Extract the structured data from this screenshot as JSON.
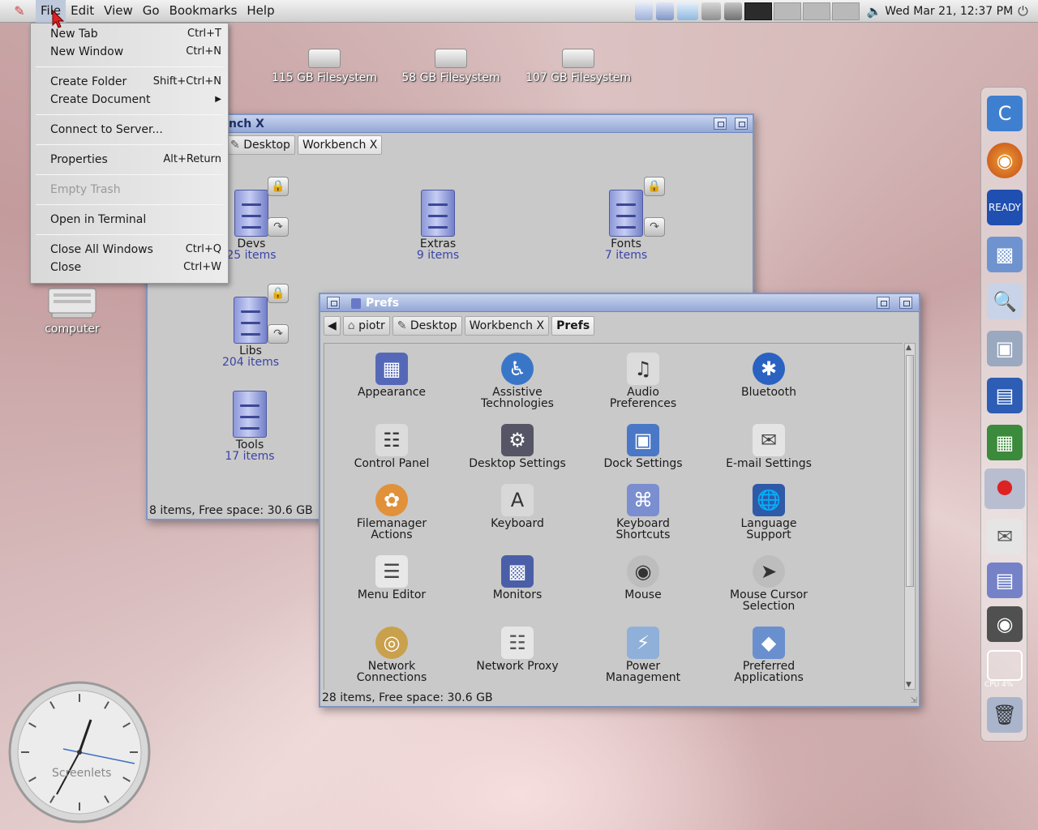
{
  "top_panel": {
    "menus": [
      "File",
      "Edit",
      "View",
      "Go",
      "Bookmarks",
      "Help"
    ],
    "datetime": "Wed Mar 21, 12:37 PM"
  },
  "file_menu": {
    "new_tab": {
      "label": "New Tab",
      "accel": "Ctrl+T"
    },
    "new_window": {
      "label": "New Window",
      "accel": "Ctrl+N"
    },
    "create_folder": {
      "label": "Create Folder",
      "accel": "Shift+Ctrl+N"
    },
    "create_document": {
      "label": "Create Document"
    },
    "connect_server": {
      "label": "Connect to Server..."
    },
    "properties": {
      "label": "Properties",
      "accel": "Alt+Return"
    },
    "empty_trash": {
      "label": "Empty Trash"
    },
    "open_terminal": {
      "label": "Open in Terminal"
    },
    "close_all": {
      "label": "Close All Windows",
      "accel": "Ctrl+Q"
    },
    "close": {
      "label": "Close",
      "accel": "Ctrl+W"
    }
  },
  "desktop": {
    "drives": [
      "115 GB Filesystem",
      "58 GB Filesystem",
      "107 GB Filesystem"
    ],
    "computer_label": "computer"
  },
  "workbench_window": {
    "title": "nch X",
    "crumbs": [
      "Desktop",
      "Workbench X"
    ],
    "items": [
      {
        "name": "Devs",
        "count": "25 items"
      },
      {
        "name": "Extras",
        "count": "9 items"
      },
      {
        "name": "Fonts",
        "count": "7 items"
      },
      {
        "name": "Libs",
        "count": "204 items"
      },
      {
        "name": "Tools",
        "count": "17 items"
      }
    ],
    "status": "8 items, Free space: 30.6 GB"
  },
  "prefs_window": {
    "title": "Prefs",
    "crumbs": [
      "piotr",
      "Desktop",
      "Workbench X",
      "Prefs"
    ],
    "items": [
      {
        "line1": "Appearance",
        "line2": ""
      },
      {
        "line1": "Assistive",
        "line2": "Technologies"
      },
      {
        "line1": "Audio",
        "line2": "Preferences"
      },
      {
        "line1": "Bluetooth",
        "line2": ""
      },
      {
        "line1": "Control Panel",
        "line2": ""
      },
      {
        "line1": "Desktop Settings",
        "line2": ""
      },
      {
        "line1": "Dock Settings",
        "line2": ""
      },
      {
        "line1": "E-mail Settings",
        "line2": ""
      },
      {
        "line1": "Filemanager",
        "line2": "Actions"
      },
      {
        "line1": "Keyboard",
        "line2": ""
      },
      {
        "line1": "Keyboard",
        "line2": "Shortcuts"
      },
      {
        "line1": "Language",
        "line2": "Support"
      },
      {
        "line1": "Menu Editor",
        "line2": ""
      },
      {
        "line1": "Monitors",
        "line2": ""
      },
      {
        "line1": "Mouse",
        "line2": ""
      },
      {
        "line1": "Mouse Cursor",
        "line2": "Selection"
      },
      {
        "line1": "Network",
        "line2": "Connections"
      },
      {
        "line1": "Network Proxy",
        "line2": ""
      },
      {
        "line1": "Power",
        "line2": "Management"
      },
      {
        "line1": "Preferred",
        "line2": "Applications"
      }
    ],
    "status": "28 items, Free space: 30.6 GB"
  },
  "dock": {
    "cpu_label": "CPU 4%"
  },
  "clock_widget": {
    "label": "Screenlets"
  },
  "colors": {
    "title_bar": "#93a7d6",
    "window_bg": "#c9c9c9",
    "item_count": "#3a44a8",
    "menu_bg": "#e3e3e3"
  }
}
